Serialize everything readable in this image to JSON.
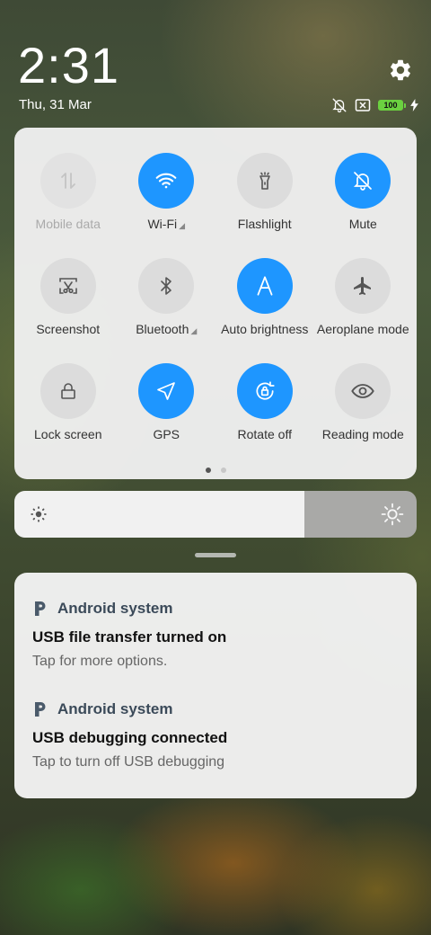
{
  "clock": {
    "time": "2:31",
    "date": "Thu, 31 Mar"
  },
  "status": {
    "battery": "100",
    "icons": [
      "bell-off-icon",
      "no-sim-icon",
      "battery-icon",
      "charging-bolt-icon"
    ]
  },
  "header": {
    "settings_icon": "gear-icon"
  },
  "quick_settings": {
    "tiles": [
      {
        "label": "Mobile data",
        "icon": "mobile-data-icon",
        "state": "disabled"
      },
      {
        "label": "Wi-Fi",
        "icon": "wifi-icon",
        "state": "on",
        "expandable": true
      },
      {
        "label": "Flashlight",
        "icon": "flashlight-icon",
        "state": "off"
      },
      {
        "label": "Mute",
        "icon": "bell-off-icon",
        "state": "on"
      },
      {
        "label": "Screenshot",
        "icon": "screenshot-icon",
        "state": "off"
      },
      {
        "label": "Bluetooth",
        "icon": "bluetooth-icon",
        "state": "off",
        "expandable": true
      },
      {
        "label": "Auto brightness",
        "icon": "auto-brightness-icon",
        "state": "on"
      },
      {
        "label": "Aeroplane mode",
        "icon": "aeroplane-icon",
        "state": "off"
      },
      {
        "label": "Lock screen",
        "icon": "lock-icon",
        "state": "off"
      },
      {
        "label": "GPS",
        "icon": "gps-icon",
        "state": "on"
      },
      {
        "label": "Rotate off",
        "icon": "rotate-lock-icon",
        "state": "on"
      },
      {
        "label": "Reading mode",
        "icon": "eye-icon",
        "state": "off"
      }
    ],
    "page_indicator": {
      "pages": 2,
      "active": 1
    },
    "colors": {
      "on": "#1e96ff",
      "off": "#dcdcdc"
    }
  },
  "brightness": {
    "level": 0.72,
    "low_icon": "brightness-low-icon",
    "high_icon": "brightness-high-icon"
  },
  "notifications": [
    {
      "app": "Android system",
      "title": "USB file transfer turned on",
      "body": "Tap for more options."
    },
    {
      "app": "Android system",
      "title": "USB debugging connected",
      "body": "Tap to turn off USB debugging"
    }
  ]
}
